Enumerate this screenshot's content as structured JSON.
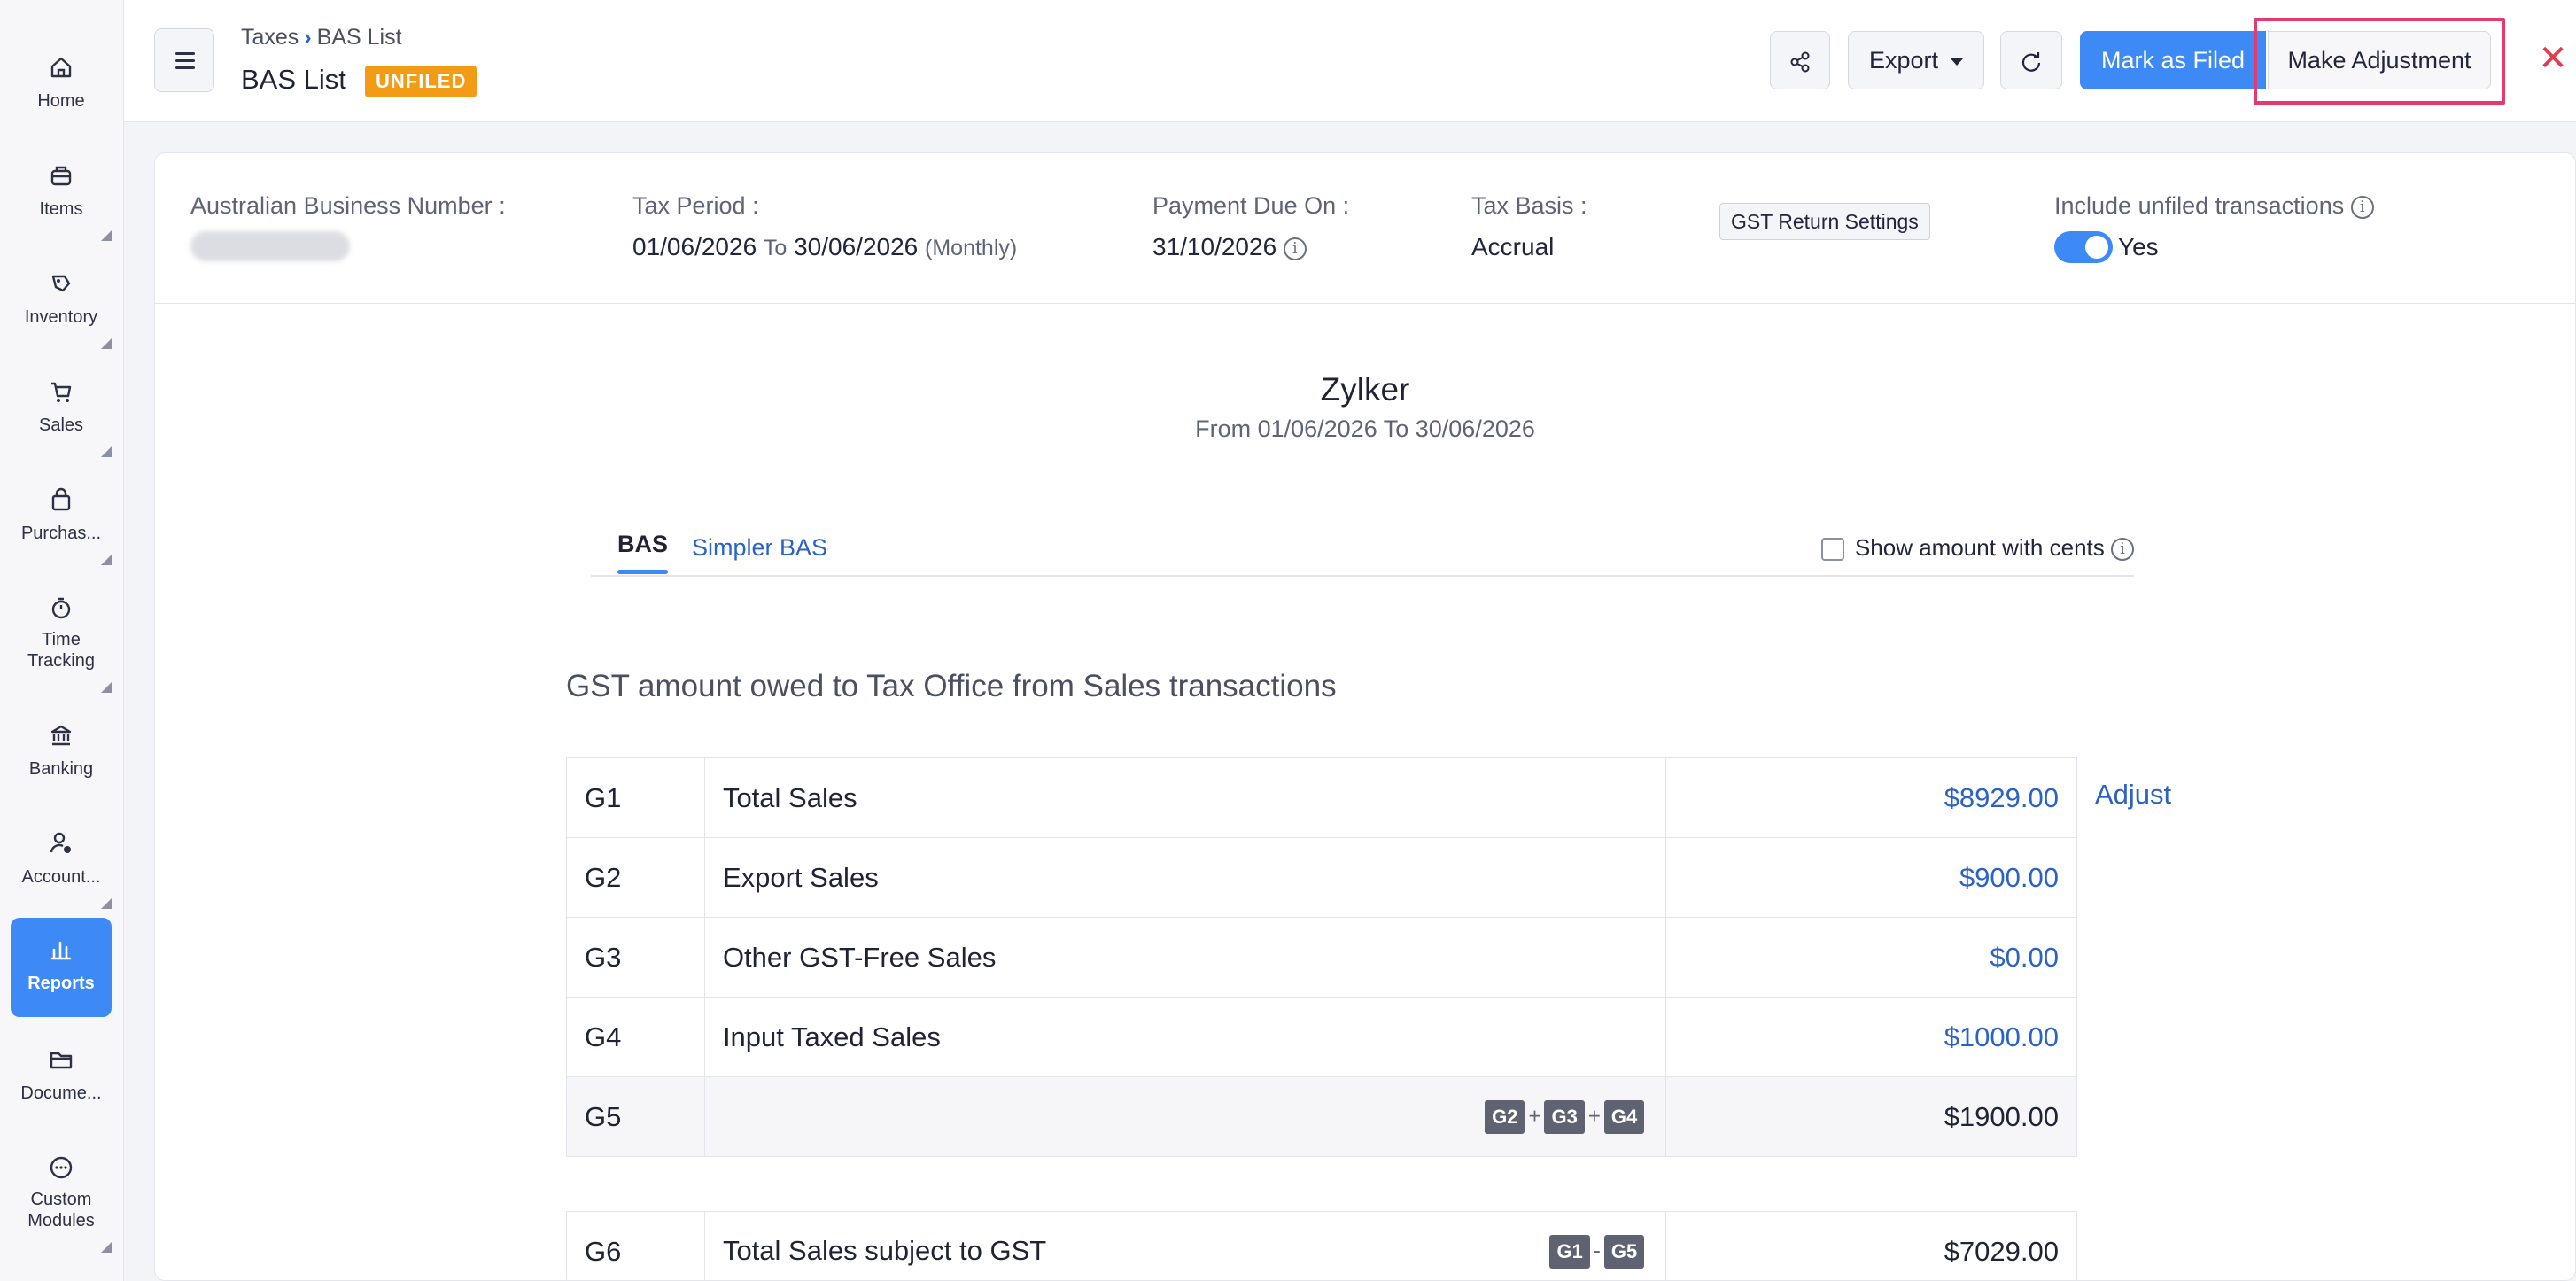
{
  "sidebar": {
    "items": [
      {
        "label": "Home",
        "icon": "home-icon"
      },
      {
        "label": "Items",
        "icon": "items-icon"
      },
      {
        "label": "Inventory",
        "icon": "inventory-icon"
      },
      {
        "label": "Sales",
        "icon": "cart-icon"
      },
      {
        "label": "Purchas...",
        "icon": "bag-icon"
      },
      {
        "label": "Time Tracking",
        "icon": "timer-icon"
      },
      {
        "label": "Banking",
        "icon": "bank-icon"
      },
      {
        "label": "Account...",
        "icon": "accountant-icon"
      },
      {
        "label": "Reports",
        "icon": "reports-icon"
      },
      {
        "label": "Docume...",
        "icon": "folder-icon"
      },
      {
        "label": "Custom Modules",
        "icon": "more-icon"
      }
    ],
    "active": "Reports"
  },
  "header": {
    "breadcrumb_parent": "Taxes",
    "breadcrumb_current": "BAS List",
    "title": "BAS List",
    "status_badge": "UNFILED",
    "export_label": "Export",
    "mark_filed_label": "Mark as Filed",
    "make_adjustment_label": "Make Adjustment",
    "close_glyph": "✕"
  },
  "meta": {
    "abn_label": "Australian Business Number :",
    "tax_period_label": "Tax Period :",
    "tax_period_from": "01/06/2026",
    "tax_period_to_word": "To",
    "tax_period_to": "30/06/2026",
    "tax_period_freq": "(Monthly)",
    "payment_due_label": "Payment Due On :",
    "payment_due_value": "31/10/2026",
    "tax_basis_label": "Tax Basis :",
    "tax_basis_value": "Accrual",
    "gst_settings_label": "GST Return Settings",
    "include_unfiled_label": "Include unfiled transactions",
    "include_unfiled_value": "Yes"
  },
  "report": {
    "org_name": "Zylker",
    "date_range": "From 01/06/2026  To 30/06/2026",
    "tabs": [
      "BAS",
      "Simpler BAS"
    ],
    "show_cents_label": "Show amount with cents",
    "section_title": "GST amount owed to Tax Office from Sales transactions",
    "adjust_label": "Adjust",
    "rows": [
      {
        "code": "G1",
        "desc": "Total Sales",
        "amount": "$8929.00"
      },
      {
        "code": "G2",
        "desc": "Export Sales",
        "amount": "$900.00"
      },
      {
        "code": "G3",
        "desc": "Other GST-Free Sales",
        "amount": "$0.00"
      },
      {
        "code": "G4",
        "desc": "Input Taxed Sales",
        "amount": "$1000.00"
      },
      {
        "code": "G5",
        "desc": "",
        "amount": "$1900.00",
        "formula": [
          "G2",
          "+",
          "G3",
          "+",
          "G4"
        ]
      }
    ],
    "rows2": [
      {
        "code": "G6",
        "desc": "Total Sales subject to GST",
        "amount": "$7029.00",
        "formula": [
          "G1",
          "-",
          "G5"
        ]
      }
    ]
  }
}
